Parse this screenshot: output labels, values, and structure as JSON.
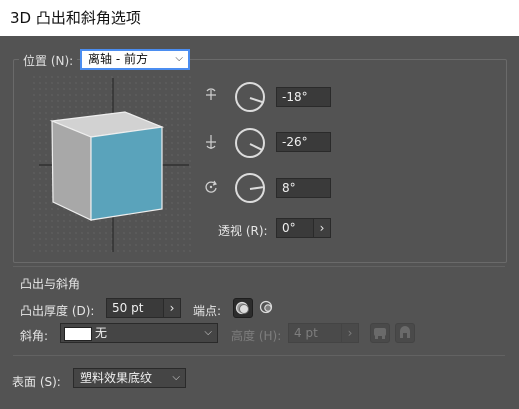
{
  "window": {
    "title": "3D 凸出和斜角选项"
  },
  "position": {
    "label": "位置 (N):",
    "value": "离轴 - 前方",
    "rot_x_value": "-18°",
    "rot_y_value": "-26°",
    "rot_z_value": "8°",
    "perspective_label": "透视 (R):",
    "perspective_value": "0°"
  },
  "extrude": {
    "section_title": "凸出与斜角",
    "depth_label": "凸出厚度 (D):",
    "depth_value": "50 pt",
    "cap_label": "端点:",
    "bevel_label": "斜角:",
    "bevel_value": "无",
    "height_label": "高度 (H):",
    "height_value": "4 pt"
  },
  "surface": {
    "label": "表面 (S):",
    "value": "塑料效果底纹"
  },
  "colors": {
    "cube_front": "#5aa3bb",
    "cube_top": "#d2d2d2",
    "cube_side": "#a8a8a8",
    "focus_ring": "#4b8df0"
  },
  "icons": {
    "rot_x": "rotate-x-axis-icon",
    "rot_y": "rotate-y-axis-icon",
    "rot_z": "rotate-z-axis-icon",
    "cap_on": "cap-on-icon",
    "cap_off": "cap-off-icon",
    "bevel_out": "bevel-extent-out-icon",
    "bevel_in": "bevel-extent-in-icon"
  }
}
